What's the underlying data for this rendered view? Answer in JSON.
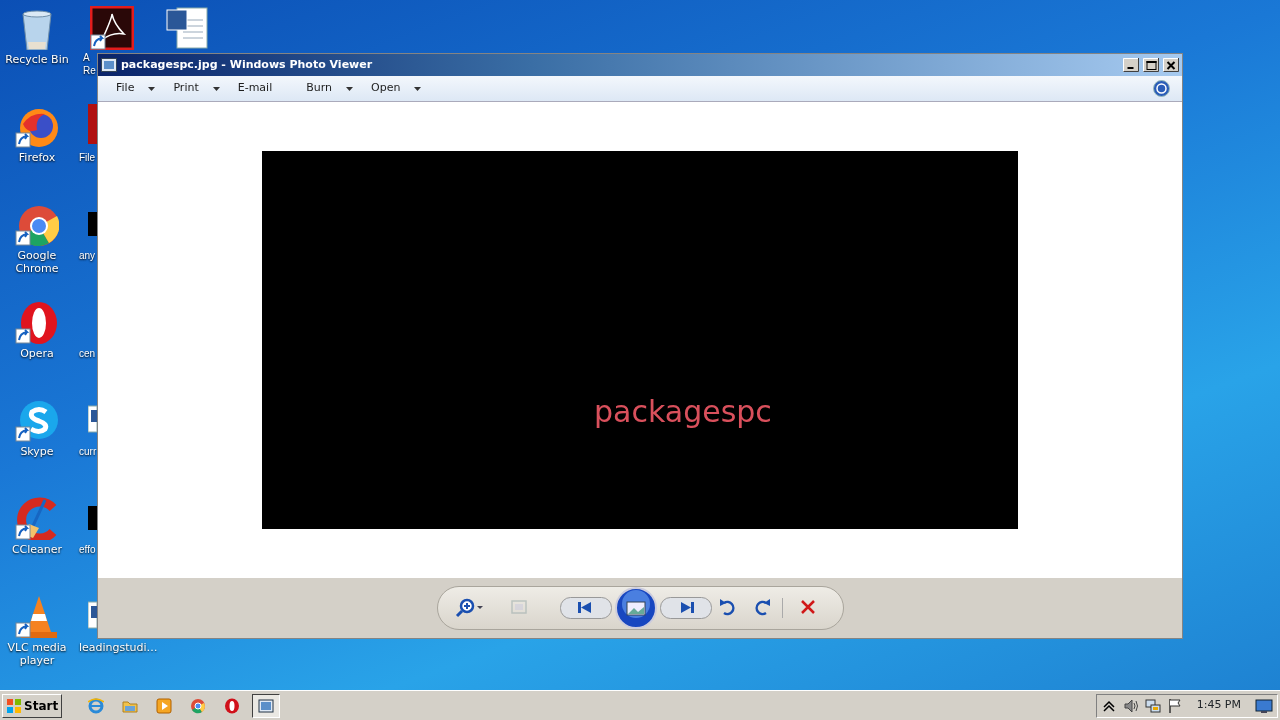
{
  "desktop": {
    "columns": [
      [
        {
          "label": "Recycle Bin",
          "kind": "recycle"
        },
        {
          "label": "Firefox",
          "kind": "firefox"
        },
        {
          "label": "Google Chrome",
          "kind": "chrome"
        },
        {
          "label": "Opera",
          "kind": "opera"
        },
        {
          "label": "Skype",
          "kind": "skype"
        },
        {
          "label": "CCleaner",
          "kind": "ccleaner"
        },
        {
          "label": "VLC media player",
          "kind": "vlc"
        }
      ],
      [
        {
          "label": "A Re",
          "kind": "pdf"
        },
        {
          "label": "File",
          "kind": "red-app"
        },
        {
          "label": "any",
          "kind": "dark-app"
        },
        {
          "label": "cen",
          "kind": "blank"
        },
        {
          "label": "curr",
          "kind": "document"
        },
        {
          "label": "effo",
          "kind": "dark-app"
        },
        {
          "label": "leadingstudi…",
          "kind": "document"
        }
      ],
      [
        {
          "kind": "word"
        }
      ]
    ]
  },
  "window": {
    "title": "packagespc.jpg - Windows Photo Viewer",
    "menu": [
      {
        "label": "File",
        "dropdown": true
      },
      {
        "label": "Print",
        "dropdown": true
      },
      {
        "label": "E-mail",
        "dropdown": false
      },
      {
        "label": "Burn",
        "dropdown": true
      },
      {
        "label": "Open",
        "dropdown": true
      }
    ],
    "image_text": "packagespc",
    "toolbar": [
      {
        "kind": "zoom",
        "disabled": false
      },
      {
        "kind": "fit",
        "disabled": true
      },
      {
        "kind": "previous",
        "disabled": false
      },
      {
        "kind": "slideshow",
        "disabled": false
      },
      {
        "kind": "next",
        "disabled": false
      },
      {
        "kind": "rotate-left",
        "disabled": false
      },
      {
        "kind": "rotate-right",
        "disabled": false
      },
      {
        "kind": "delete",
        "disabled": false
      }
    ]
  },
  "taskbar": {
    "start": "Start",
    "apps": [
      {
        "kind": "ie",
        "selected": false
      },
      {
        "kind": "folder",
        "selected": false
      },
      {
        "kind": "media",
        "selected": false
      },
      {
        "kind": "chrome",
        "selected": false
      },
      {
        "kind": "opera",
        "selected": false
      },
      {
        "kind": "photo",
        "selected": true
      }
    ],
    "time": "1:45 PM"
  }
}
